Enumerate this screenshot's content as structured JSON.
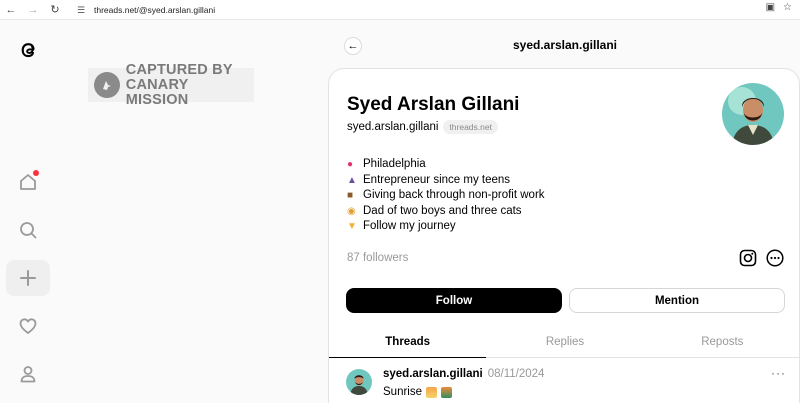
{
  "browser": {
    "url": "threads.net/@syed.arslan.gillani"
  },
  "watermark": {
    "line1": "CAPTURED BY",
    "line2": "CANARY MISSION"
  },
  "header": {
    "title": "syed.arslan.gillani"
  },
  "profile": {
    "name": "Syed Arslan Gillani",
    "handle": "syed.arslan.gillani",
    "domain_badge": "threads.net",
    "bio": [
      {
        "icon": "pin-icon",
        "text": "Philadelphia"
      },
      {
        "icon": "businessman-icon",
        "text": "Entrepreneur since my teens"
      },
      {
        "icon": "briefcase-icon",
        "text": "Giving back through non-profit work"
      },
      {
        "icon": "family-icon",
        "text": "Dad of two boys and three cats"
      },
      {
        "icon": "pointing-down-icon",
        "text": "Follow my journey"
      }
    ],
    "followers": "87 followers"
  },
  "actions": {
    "follow_label": "Follow",
    "mention_label": "Mention"
  },
  "tabs": [
    {
      "label": "Threads",
      "active": true
    },
    {
      "label": "Replies",
      "active": false
    },
    {
      "label": "Reposts",
      "active": false
    }
  ],
  "posts": [
    {
      "username": "syed.arslan.gillani",
      "date": "08/11/2024",
      "text": "Sunrise"
    }
  ],
  "colors": {
    "notification": "#ff3040",
    "follow_bg": "#000000",
    "muted_text": "#999999"
  }
}
